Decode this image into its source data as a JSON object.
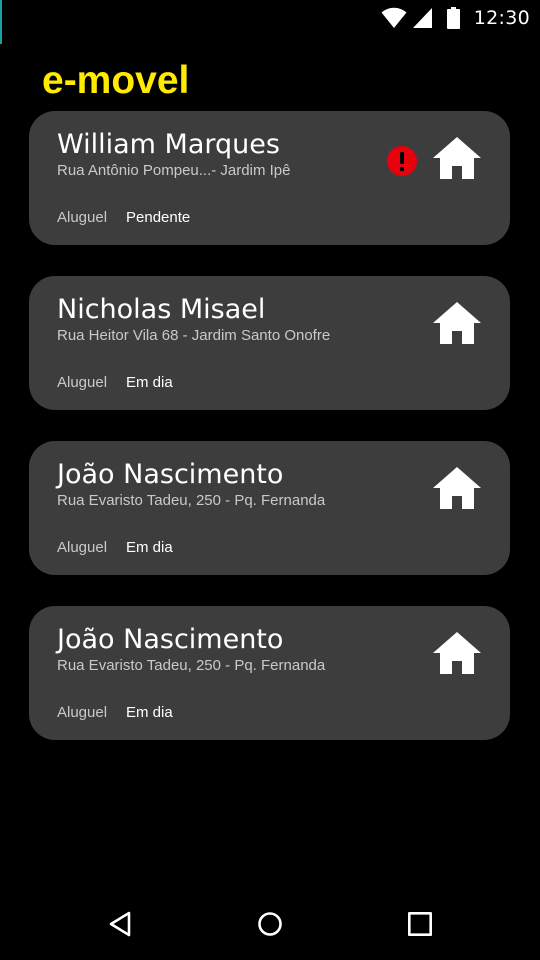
{
  "status_bar": {
    "time": "12:30",
    "icons": [
      "wifi-icon",
      "signal-icon",
      "battery-icon"
    ]
  },
  "app": {
    "title": "e-movel",
    "title_color": "#ffea00"
  },
  "properties": [
    {
      "name": "William Marques",
      "address": "Rua Antônio Pompeu...- Jardim Ipê",
      "type": "Aluguel",
      "status": "Pendente",
      "alert": true,
      "icon": "house-icon"
    },
    {
      "name": "Nicholas Misael",
      "address": "Rua Heitor Vila 68 - Jardim Santo Onofre",
      "type": "Aluguel",
      "status": "Em dia",
      "alert": false,
      "icon": "house-icon"
    },
    {
      "name": "João Nascimento",
      "address": "Rua Evaristo Tadeu, 250 - Pq. Fernanda",
      "type": "Aluguel",
      "status": "Em dia",
      "alert": false,
      "icon": "house-icon"
    },
    {
      "name": "João Nascimento",
      "address": "Rua Evaristo Tadeu, 250 - Pq. Fernanda",
      "type": "Aluguel",
      "status": "Em dia",
      "alert": false,
      "icon": "house-icon"
    }
  ],
  "colors": {
    "card_background": "#3d3d3d",
    "alert": "#e8000d"
  },
  "nav_bar": {
    "icons": [
      "back-icon",
      "home-icon",
      "recents-icon"
    ]
  }
}
